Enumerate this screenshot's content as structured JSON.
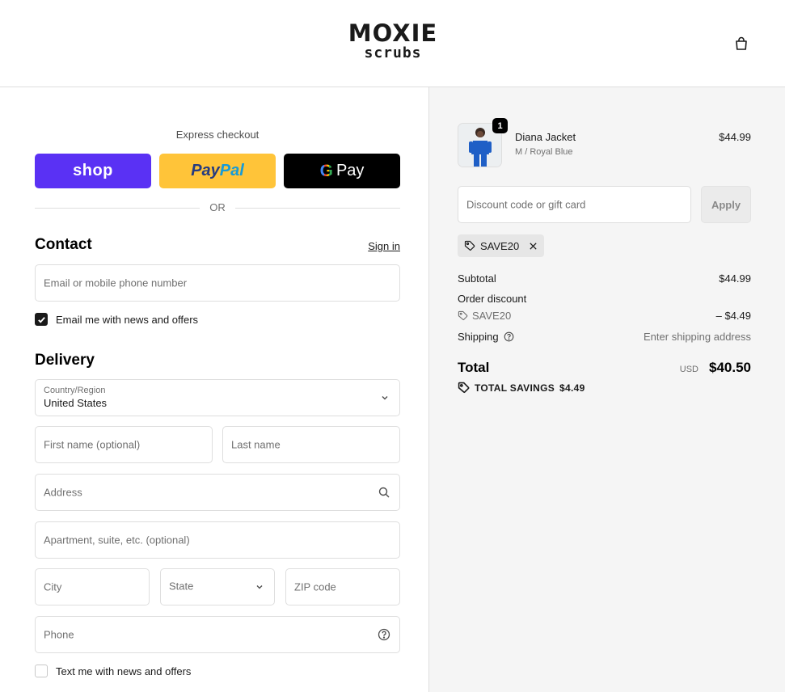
{
  "brand": {
    "top": "MOXIE",
    "bottom": "scrubs"
  },
  "express": {
    "title": "Express checkout",
    "shop_label": "shop",
    "paypal_a": "Pay",
    "paypal_b": "Pal",
    "gpay_g": "G",
    "gpay_label": "Pay",
    "or_label": "OR"
  },
  "contact": {
    "title": "Contact",
    "sign_in": "Sign in",
    "email_placeholder": "Email or mobile phone number",
    "news_label": "Email me with news and offers",
    "news_checked": true
  },
  "delivery": {
    "title": "Delivery",
    "country_label": "Country/Region",
    "country_value": "United States",
    "first_name_placeholder": "First name (optional)",
    "last_name_placeholder": "Last name",
    "address_placeholder": "Address",
    "apartment_placeholder": "Apartment, suite, etc. (optional)",
    "city_placeholder": "City",
    "state_placeholder": "State",
    "zip_placeholder": "ZIP code",
    "phone_placeholder": "Phone",
    "sms_label": "Text me with news and offers",
    "sms_checked": false
  },
  "order": {
    "item": {
      "name": "Diana Jacket",
      "variant": "M / Royal Blue",
      "price": "$44.99",
      "quantity": "1"
    },
    "discount_placeholder": "Discount code or gift card",
    "apply_label": "Apply",
    "applied_code": "SAVE20",
    "subtotal_label": "Subtotal",
    "subtotal_value": "$44.99",
    "order_discount_label": "Order discount",
    "discount_code": "SAVE20",
    "discount_value": "– $4.49",
    "shipping_label": "Shipping",
    "shipping_value": "Enter shipping address",
    "total_label": "Total",
    "total_currency": "USD",
    "total_value": "$40.50",
    "savings_label": "TOTAL SAVINGS",
    "savings_value": "$4.49"
  },
  "colors": {
    "shop_pay": "#5a31f4",
    "paypal": "#ffc439",
    "gpay": "#000000",
    "summary_bg": "#f5f5f5"
  },
  "icons": {
    "cart": "shopping-bag-icon",
    "search": "search-icon",
    "help": "question-circle-icon",
    "tag": "tag-icon",
    "chevron": "chevron-down-icon",
    "close": "close-icon"
  }
}
